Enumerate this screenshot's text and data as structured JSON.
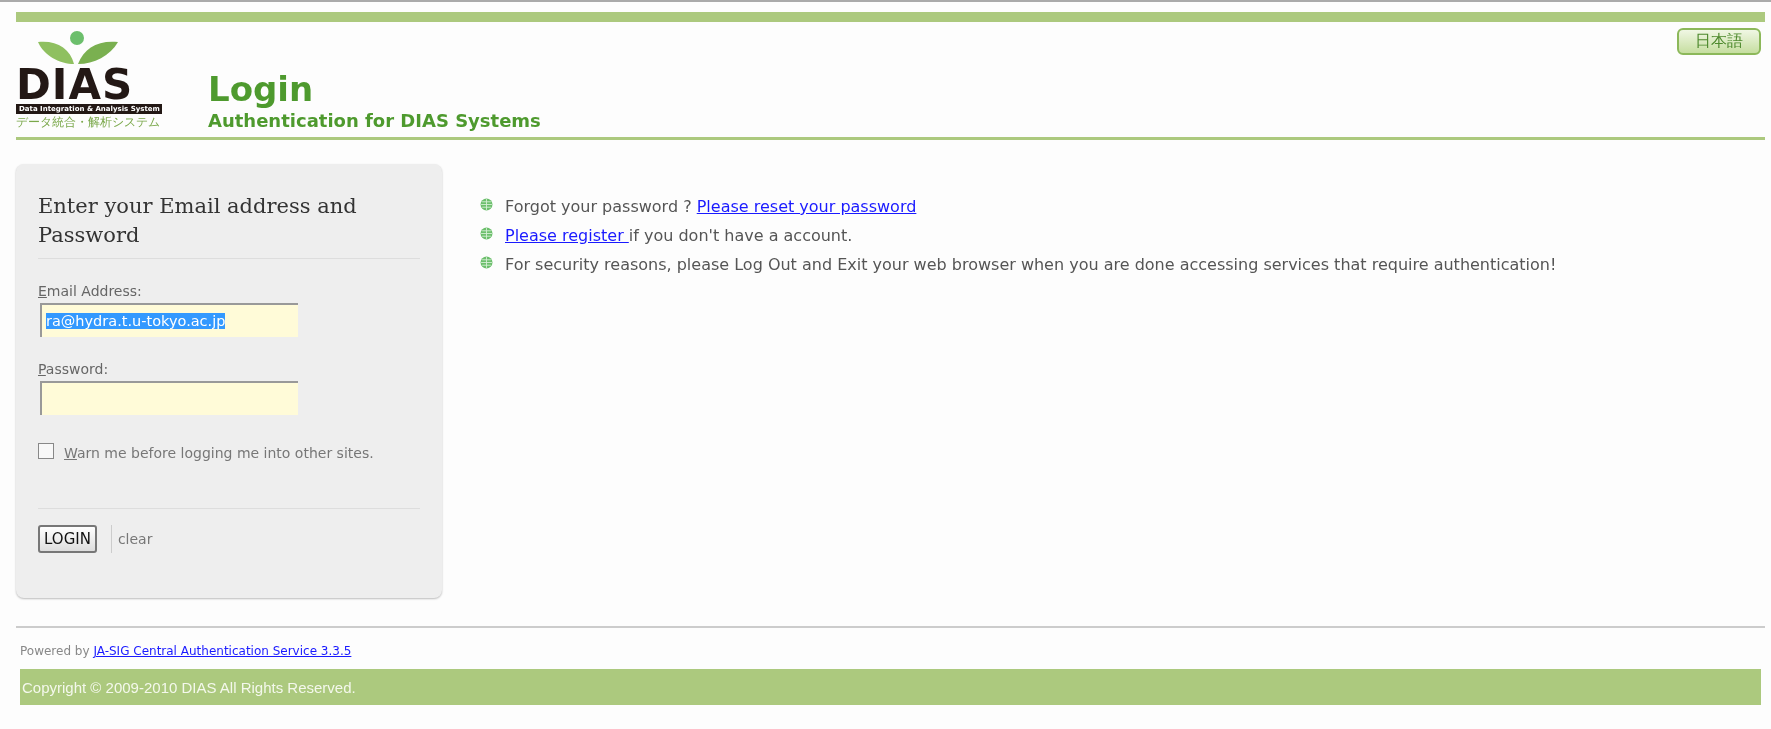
{
  "header": {
    "logo": {
      "wordmark": "DIAS",
      "tagline": "Data Integration & Analysis System",
      "japanese": "データ統合・解析システム"
    },
    "title": "Login",
    "subtitle": "Authentication for DIAS Systems",
    "language_button": "日本語"
  },
  "login_form": {
    "heading": "Enter your Email address and Password",
    "fields": [
      {
        "label": "Email Address:",
        "value": "ra@hydra.t.u-tokyo.ac.jp",
        "value_selected": true
      },
      {
        "label": "Password:"
      }
    ],
    "warn_checkbox": {
      "label": "Warn me before logging me into other sites.",
      "checked": false
    },
    "login_button": "LOGIN",
    "clear_link": "clear"
  },
  "notices": [
    {
      "before": "Forgot your password ? ",
      "link": "Please reset your password"
    },
    {
      "link": "Please register ",
      "after": "if you don't have a account."
    },
    {
      "before": "For security reasons, please Log Out and Exit your web browser when you are done accessing services that require authentication!"
    }
  ],
  "footer": {
    "powered_by": "Powered by",
    "powered_link": "JA-SIG Central Authentication Service 3.3.5",
    "copyright": "Copyright © 2009-2010 DIAS All Rights Reserved."
  }
}
